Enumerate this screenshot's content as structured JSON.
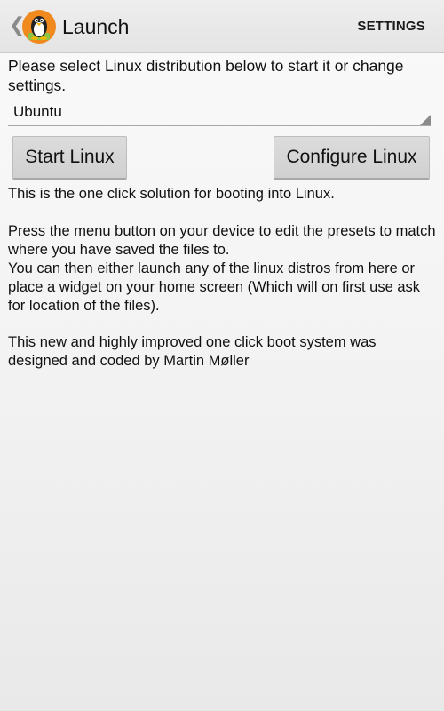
{
  "action_bar": {
    "title": "Launch",
    "settings_label": "SETTINGS",
    "icon": "tux-penguin-icon"
  },
  "main": {
    "prompt": "Please select Linux distribution below to start it or change settings.",
    "distro_spinner": {
      "selected": "Ubuntu"
    },
    "buttons": {
      "start_label": "Start Linux",
      "configure_label": "Configure Linux"
    },
    "paragraphs": [
      "This is the one click solution for booting into Linux.",
      "Press the menu button on your device to edit the presets to match where you have saved the files to.",
      "You can then either launch any of the linux distros from here or place a widget on your home screen (Which will on first use ask for location of the files).",
      "This new and highly improved one click boot system was designed and coded by Martin Møller"
    ]
  },
  "colors": {
    "action_bar_bg": "#e8e8e8",
    "icon_circle": "#f08a1e",
    "button_bg": "#d6d6d6"
  }
}
